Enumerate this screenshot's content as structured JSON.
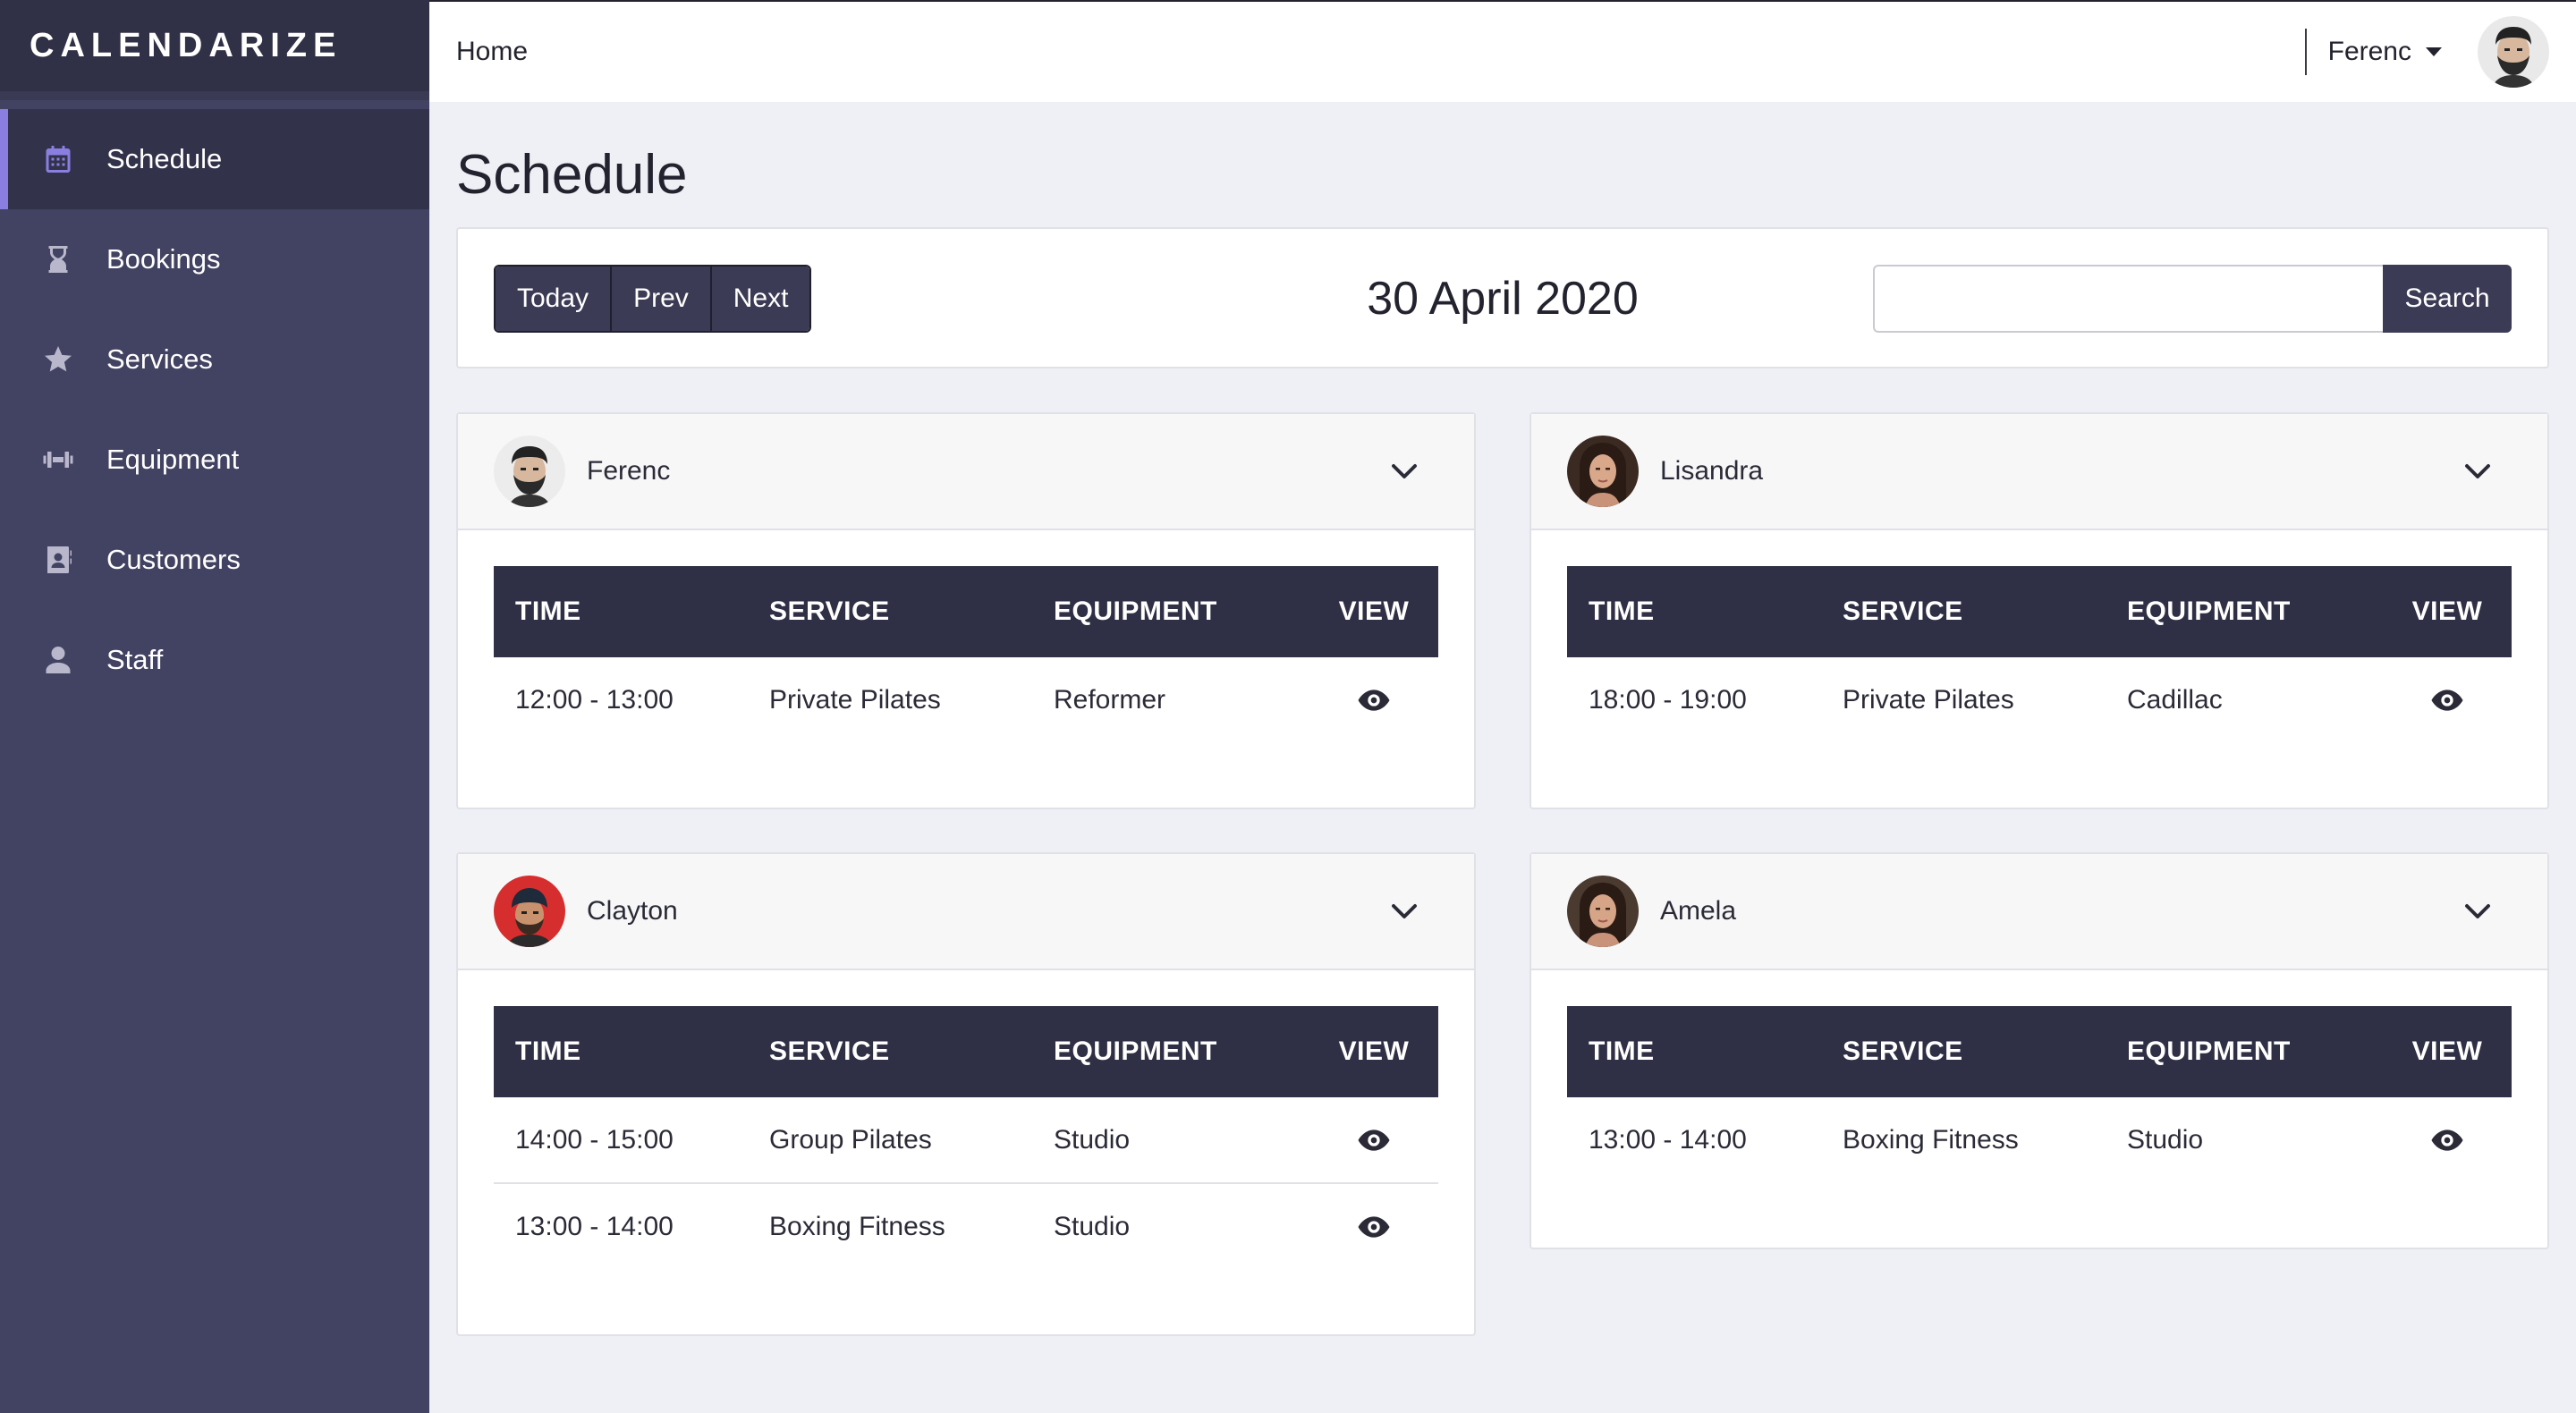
{
  "app": {
    "brand": "CALENDARIZE"
  },
  "sidebar": {
    "items": [
      {
        "label": "Schedule",
        "icon": "calendar-icon",
        "active": true
      },
      {
        "label": "Bookings",
        "icon": "hourglass-icon",
        "active": false
      },
      {
        "label": "Services",
        "icon": "star-icon",
        "active": false
      },
      {
        "label": "Equipment",
        "icon": "dumbbell-icon",
        "active": false
      },
      {
        "label": "Customers",
        "icon": "contact-book-icon",
        "active": false
      },
      {
        "label": "Staff",
        "icon": "user-icon",
        "active": false
      }
    ]
  },
  "topbar": {
    "breadcrumb": "Home",
    "user_name": "Ferenc"
  },
  "page": {
    "title": "Schedule"
  },
  "toolbar": {
    "today_label": "Today",
    "prev_label": "Prev",
    "next_label": "Next",
    "date": "30 April 2020",
    "search_placeholder": "",
    "search_value": "",
    "search_label": "Search"
  },
  "table_headers": {
    "time": "TIME",
    "service": "SERVICE",
    "equipment": "EQUIPMENT",
    "view": "VIEW"
  },
  "staff_cards": [
    {
      "name": "Ferenc",
      "rows": [
        {
          "time": "12:00 - 13:00",
          "service": "Private Pilates",
          "equipment": "Reformer"
        }
      ]
    },
    {
      "name": "Lisandra",
      "rows": [
        {
          "time": "18:00 - 19:00",
          "service": "Private Pilates",
          "equipment": "Cadillac"
        }
      ]
    },
    {
      "name": "Clayton",
      "rows": [
        {
          "time": "14:00 - 15:00",
          "service": "Group Pilates",
          "equipment": "Studio"
        },
        {
          "time": "13:00 - 14:00",
          "service": "Boxing Fitness",
          "equipment": "Studio"
        }
      ]
    },
    {
      "name": "Amela",
      "rows": [
        {
          "time": "13:00 - 14:00",
          "service": "Boxing Fitness",
          "equipment": "Studio"
        }
      ]
    }
  ],
  "colors": {
    "sidebar_bg": "#424262",
    "sidebar_active_bg": "#32324a",
    "accent": "#8a7fe0",
    "table_header_bg": "#2f2f45",
    "button_bg": "#3b3b55"
  }
}
